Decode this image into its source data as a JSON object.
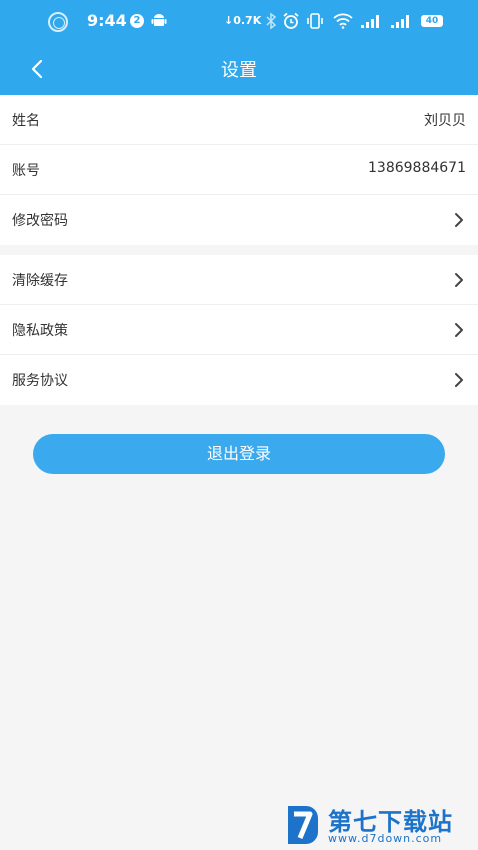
{
  "status_bar": {
    "time": "9:44",
    "notification_count": "2",
    "net_speed": "0.7K",
    "battery": "40"
  },
  "nav": {
    "title": "设置"
  },
  "profile": {
    "name_label": "姓名",
    "name_value": "刘贝贝",
    "account_label": "账号",
    "account_value": "13869884671",
    "password_label": "修改密码"
  },
  "misc": {
    "items": [
      {
        "label": "清除缓存"
      },
      {
        "label": "隐私政策"
      },
      {
        "label": "服务协议"
      }
    ]
  },
  "logout_label": "退出登录",
  "watermark": {
    "brand": "第七下载站",
    "url": "www.d7down.com"
  },
  "colors": {
    "primary": "#2fa8ee",
    "button": "#3aa9ee",
    "background": "#f5f5f5",
    "watermark": "#1c73c9"
  },
  "icons": [
    "back-arrow-icon",
    "chevron-right-icon",
    "android-icon",
    "bluetooth-icon",
    "alarm-icon",
    "vibrate-icon",
    "wifi-icon",
    "signal-icon",
    "battery-icon"
  ]
}
